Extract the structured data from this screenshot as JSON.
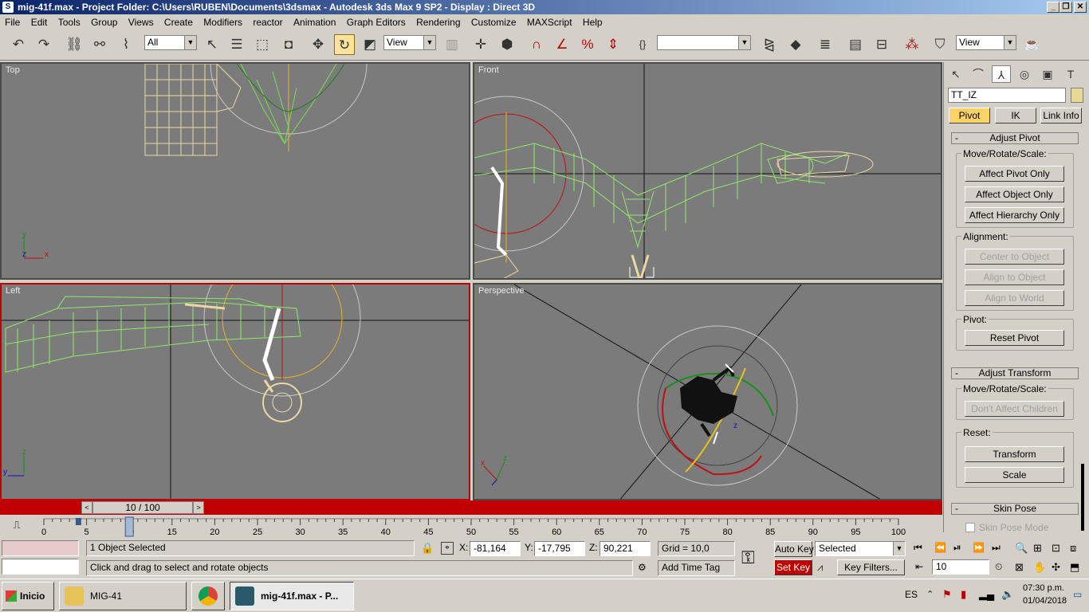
{
  "window": {
    "title": "mig-41f.max   - Project Folder: C:\\Users\\RUBEN\\Documents\\3dsmax    - Autodesk 3ds Max 9 SP2     - Display : Direct 3D",
    "app_icon": "3ds-max-icon"
  },
  "menu": [
    "File",
    "Edit",
    "Tools",
    "Group",
    "Views",
    "Create",
    "Modifiers",
    "reactor",
    "Animation",
    "Graph Editors",
    "Rendering",
    "Customize",
    "MAXScript",
    "Help"
  ],
  "toolbar": {
    "selection_filter": "All",
    "ref_coord": "View",
    "named_selection": "",
    "view_dropdown": "View"
  },
  "viewports": {
    "top": "Top",
    "front": "Front",
    "left": "Left",
    "perspective": "Perspective"
  },
  "command_panel": {
    "object_name": "TT_IZ",
    "object_color": "#e8d99a",
    "hierarchy_tabs": [
      "Pivot",
      "IK",
      "Link Info"
    ],
    "adjust_pivot": {
      "title": "Adjust Pivot",
      "move_group": "Move/Rotate/Scale:",
      "affect_pivot": "Affect Pivot Only",
      "affect_object": "Affect Object Only",
      "affect_hierarchy": "Affect Hierarchy Only",
      "alignment_group": "Alignment:",
      "center": "Center to Object",
      "align_object": "Align to Object",
      "align_world": "Align to World",
      "pivot_group": "Pivot:",
      "reset_pivot": "Reset Pivot"
    },
    "adjust_transform": {
      "title": "Adjust Transform",
      "move_group": "Move/Rotate/Scale:",
      "dont_affect": "Don't Affect Children",
      "reset_group": "Reset:",
      "transform": "Transform",
      "scale": "Scale"
    },
    "skin_pose": {
      "title": "Skin Pose",
      "mode": "Skin Pose Mode"
    }
  },
  "timeline": {
    "slider_label": "10 / 100",
    "current_frame": 10,
    "total_frames": 100,
    "ticks": [
      "0",
      "5",
      "10",
      "15",
      "20",
      "25",
      "30",
      "35",
      "40",
      "45",
      "50",
      "55",
      "60",
      "65",
      "70",
      "75",
      "80",
      "85",
      "90",
      "95",
      "100"
    ]
  },
  "status": {
    "selection": "1 Object Selected",
    "prompt": "Click and drag to select and rotate objects",
    "x_label": "X:",
    "x": "-81,164",
    "y_label": "Y:",
    "y": "-17,795",
    "z_label": "Z:",
    "z": "90,221",
    "grid": "Grid = 10,0",
    "add_time_tag": "Add Time Tag",
    "auto_key": "Auto Key",
    "set_key": "Set Key",
    "selected": "Selected",
    "key_filters": "Key Filters...",
    "frame_field": "10"
  },
  "taskbar": {
    "start": "Inicio",
    "tasks": [
      "MIG-41",
      "mig-41f.max    - P..."
    ],
    "language": "ES",
    "time": "07:30 p.m.",
    "date": "01/04/2018"
  },
  "colors": {
    "viewport_bg": "#7b7b7b",
    "active_border": "#c00000",
    "wire_green": "#8fe86a",
    "wire_yellow": "#e8d9a2",
    "selected_button": "#fbd266"
  }
}
